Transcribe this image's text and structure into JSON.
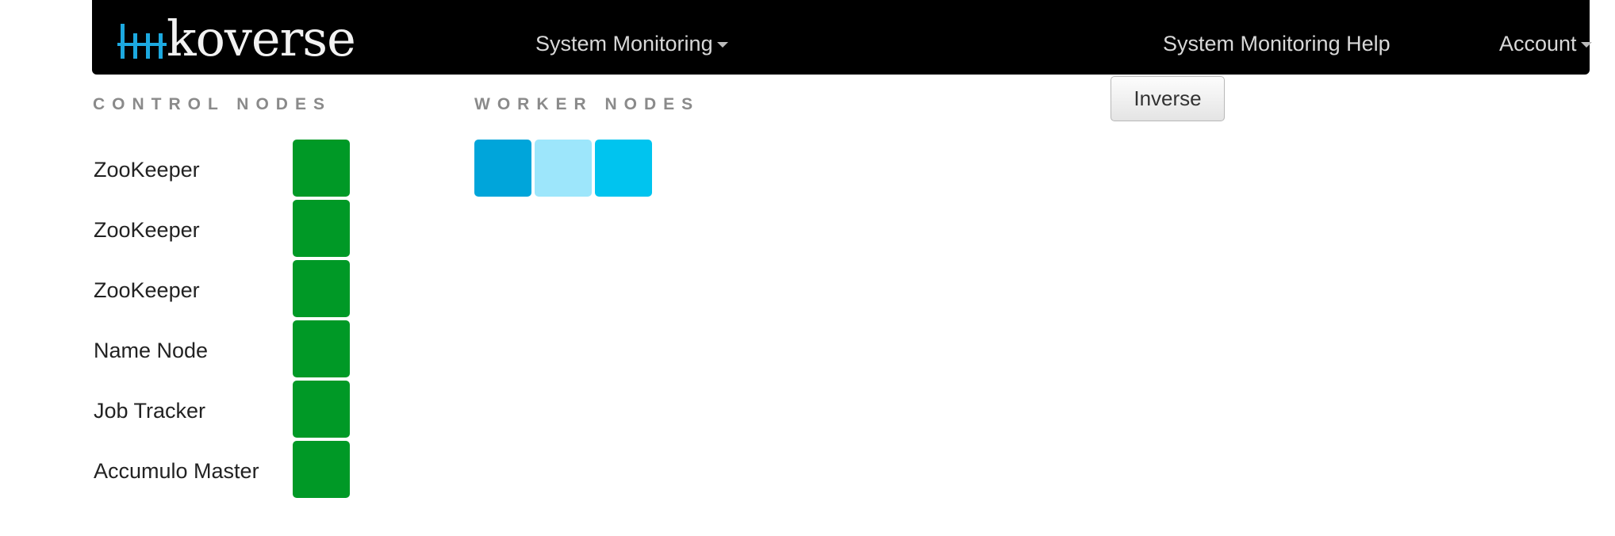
{
  "navbar": {
    "brand": {
      "text": "koverse",
      "icon": "koverse-bars-logo-icon"
    },
    "menu_monitoring": {
      "label": "System Monitoring",
      "icon": "caret-down-icon"
    },
    "menu_help": {
      "label": "System Monitoring Help"
    },
    "menu_account": {
      "label": "Account",
      "icon": "caret-down-icon"
    }
  },
  "inverse_button": {
    "label": "Inverse"
  },
  "control_nodes": {
    "heading": "CONTROL NODES",
    "status_color": "#009926",
    "items": [
      {
        "label": "ZooKeeper"
      },
      {
        "label": "ZooKeeper"
      },
      {
        "label": "ZooKeeper"
      },
      {
        "label": "Name Node"
      },
      {
        "label": "Job Tracker"
      },
      {
        "label": "Accumulo Master"
      }
    ]
  },
  "worker_nodes": {
    "heading": "WORKER NODES",
    "items": [
      {
        "color": "#00a5da"
      },
      {
        "color": "#9de6fb"
      },
      {
        "color": "#00c4ef"
      }
    ]
  },
  "colors": {
    "navbar_bg": "#000000",
    "brand_accent": "#1ca9e0",
    "heading_gray": "#8a8a8a"
  }
}
